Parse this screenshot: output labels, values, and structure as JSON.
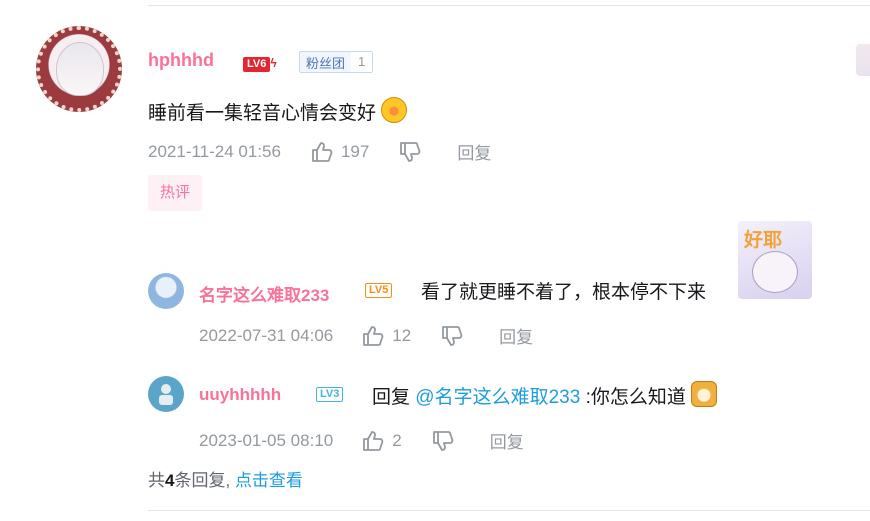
{
  "comment": {
    "username": "hphhhd",
    "level": "LV6",
    "fan_badge": {
      "name": "粉丝团",
      "level": "1"
    },
    "text": "睡前看一集轻音心情会变好",
    "timestamp": "2021-11-24 01:56",
    "likes": "197",
    "reply_label": "回复",
    "hot_tag": "热评"
  },
  "replies": [
    {
      "username": "名字这么难取233",
      "level": "LV5",
      "text": "看了就更睡不着了，根本停不下来",
      "sticker_text": "好耶",
      "timestamp": "2022-07-31 04:06",
      "likes": "12",
      "reply_label": "回复"
    },
    {
      "username": "uuyhhhhh",
      "level": "LV3",
      "text_prefix": "回复",
      "mention": "@名字这么难取233",
      "text": ":你怎么知道",
      "timestamp": "2023-01-05 08:10",
      "likes": "2",
      "reply_label": "回复"
    }
  ],
  "footer": {
    "prefix": "共",
    "count": "4",
    "suffix": "条回复,",
    "view_link": "点击查看"
  },
  "colors": {
    "accent": "#fb7299",
    "link": "#1b9de0",
    "meta": "#9499a0"
  }
}
